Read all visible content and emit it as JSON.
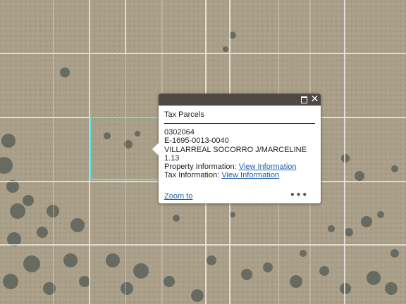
{
  "map": {
    "imagery": "aerial-desert",
    "parcel_line_color": "#f2f0ec",
    "selected_parcel_color": "#56e6df"
  },
  "popup": {
    "title": "Tax Parcels",
    "parcel_id": "0302064",
    "parcel_code": "E-1695-0013-0040",
    "owner": "VILLARREAL SOCORRO J/MARCELINE",
    "acreage": "1.13",
    "property_info_label": "Property Information:",
    "property_info_link": "View Information",
    "tax_info_label": "Tax Information:",
    "tax_info_link": "View Information",
    "zoom_link": "Zoom to",
    "more_icon": "ellipsis-icon",
    "maximize_icon": "maximize-icon",
    "close_icon": "close-icon"
  }
}
